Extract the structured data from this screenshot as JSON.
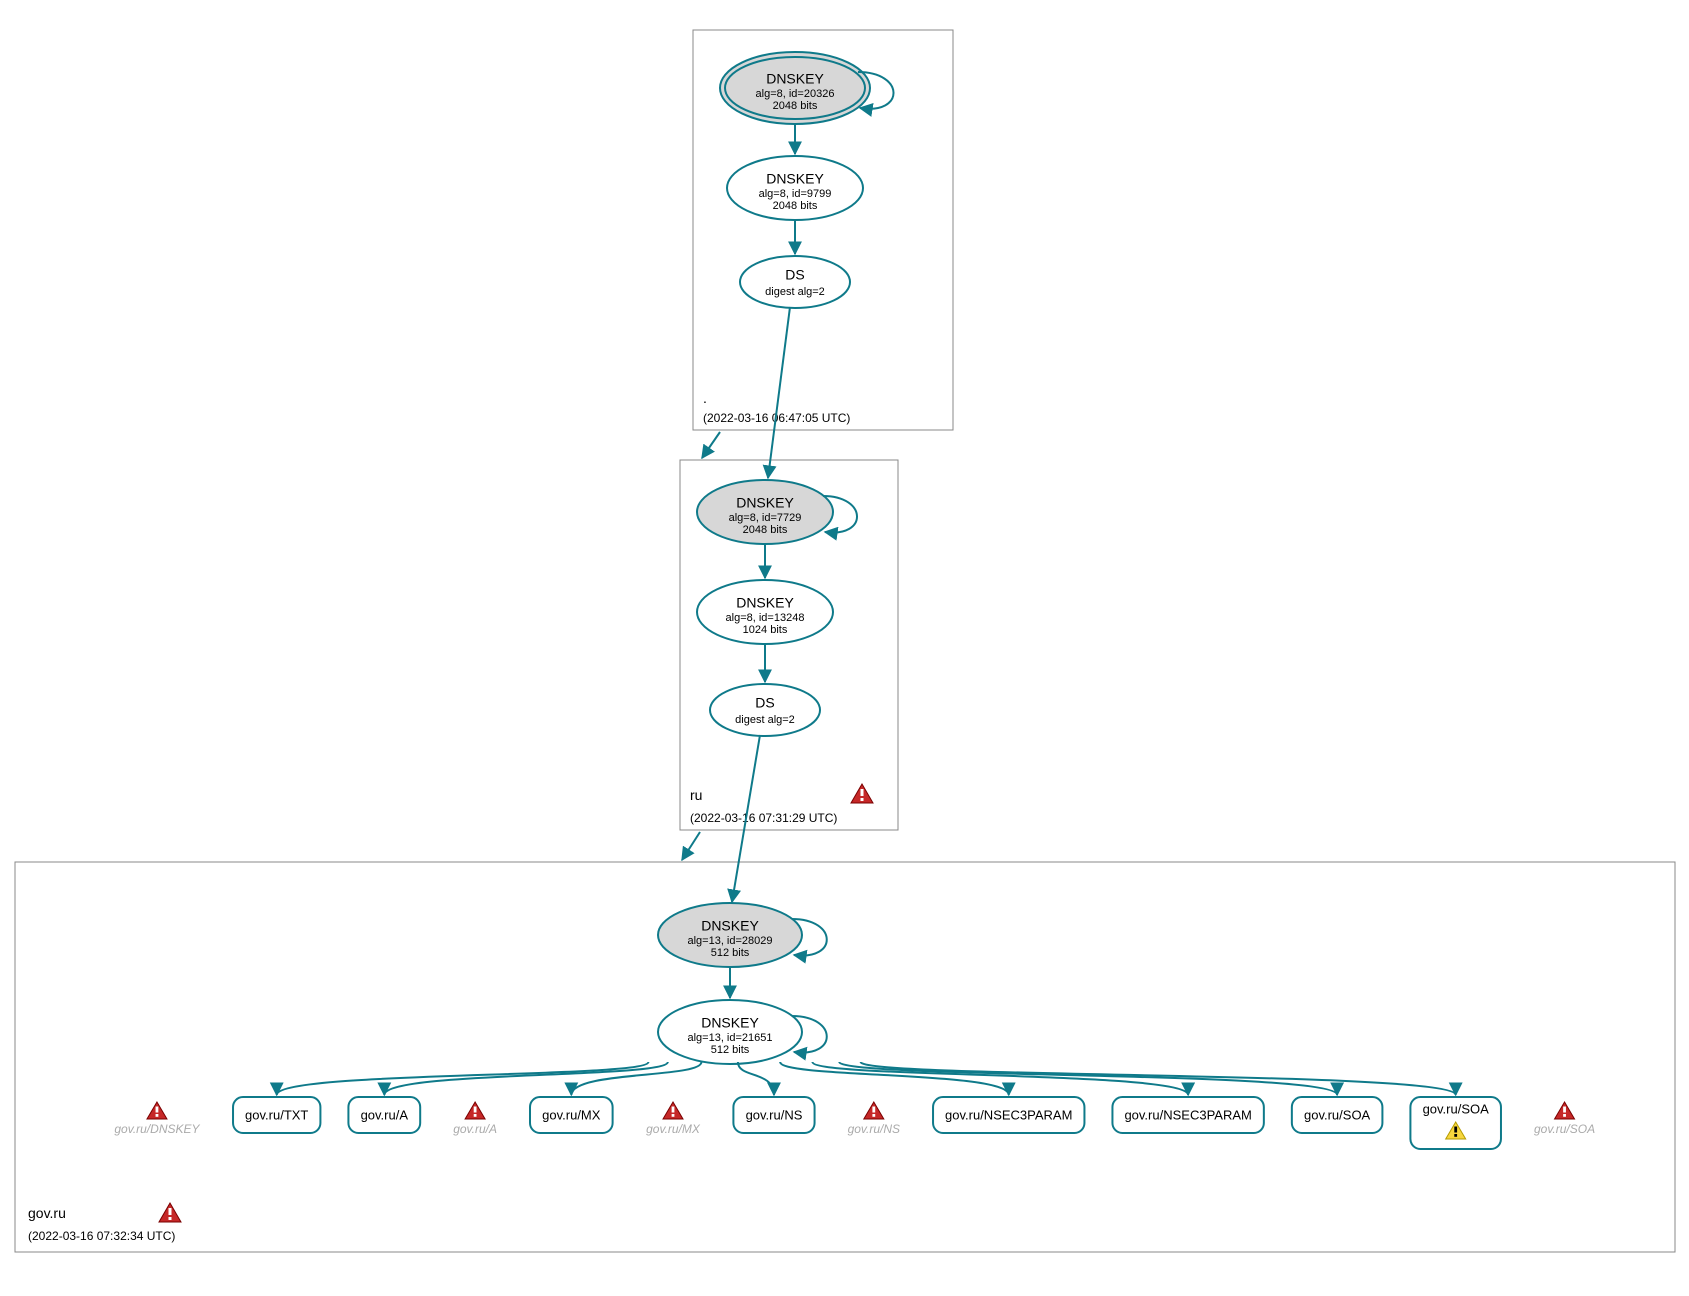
{
  "colors": {
    "teal": "#0f7a8a",
    "grey_fill": "#d7d7d7",
    "white": "#ffffff",
    "box_stroke": "#7a7a7a",
    "yellow": "#f7d63e",
    "red": "#c62828"
  },
  "zones": [
    {
      "id": "root",
      "label": ".",
      "timestamp": "(2022-03-16 06:47:05 UTC)",
      "warning": false
    },
    {
      "id": "ru",
      "label": "ru",
      "timestamp": "(2022-03-16 07:31:29 UTC)",
      "warning": true
    },
    {
      "id": "govru",
      "label": "gov.ru",
      "timestamp": "(2022-03-16 07:32:34 UTC)",
      "warning": true
    }
  ],
  "nodes": {
    "root_ksk": {
      "title": "DNSKEY",
      "line1": "alg=8, id=20326",
      "line2": "2048 bits"
    },
    "root_zsk": {
      "title": "DNSKEY",
      "line1": "alg=8, id=9799",
      "line2": "2048 bits"
    },
    "root_ds": {
      "title": "DS",
      "line1": "digest alg=2",
      "line2": ""
    },
    "ru_ksk": {
      "title": "DNSKEY",
      "line1": "alg=8, id=7729",
      "line2": "2048 bits"
    },
    "ru_zsk": {
      "title": "DNSKEY",
      "line1": "alg=8, id=13248",
      "line2": "1024 bits"
    },
    "ru_ds": {
      "title": "DS",
      "line1": "digest alg=2",
      "line2": ""
    },
    "gov_ksk": {
      "title": "DNSKEY",
      "line1": "alg=13, id=28029",
      "line2": "512 bits"
    },
    "gov_zsk": {
      "title": "DNSKEY",
      "line1": "alg=13, id=21651",
      "line2": "512 bits"
    }
  },
  "rrsets": [
    {
      "type": "ghost",
      "label": "gov.ru/DNSKEY",
      "warn": "red"
    },
    {
      "type": "rect",
      "label": "gov.ru/TXT"
    },
    {
      "type": "rect",
      "label": "gov.ru/A"
    },
    {
      "type": "ghost",
      "label": "gov.ru/A",
      "warn": "red"
    },
    {
      "type": "rect",
      "label": "gov.ru/MX"
    },
    {
      "type": "ghost",
      "label": "gov.ru/MX",
      "warn": "red"
    },
    {
      "type": "rect",
      "label": "gov.ru/NS"
    },
    {
      "type": "ghost",
      "label": "gov.ru/NS",
      "warn": "red"
    },
    {
      "type": "rect",
      "label": "gov.ru/NSEC3PARAM"
    },
    {
      "type": "rect",
      "label": "gov.ru/NSEC3PARAM"
    },
    {
      "type": "rect",
      "label": "gov.ru/SOA"
    },
    {
      "type": "rect",
      "label": "gov.ru/SOA",
      "warn": "yellow"
    },
    {
      "type": "ghost",
      "label": "gov.ru/SOA",
      "warn": "red"
    }
  ]
}
